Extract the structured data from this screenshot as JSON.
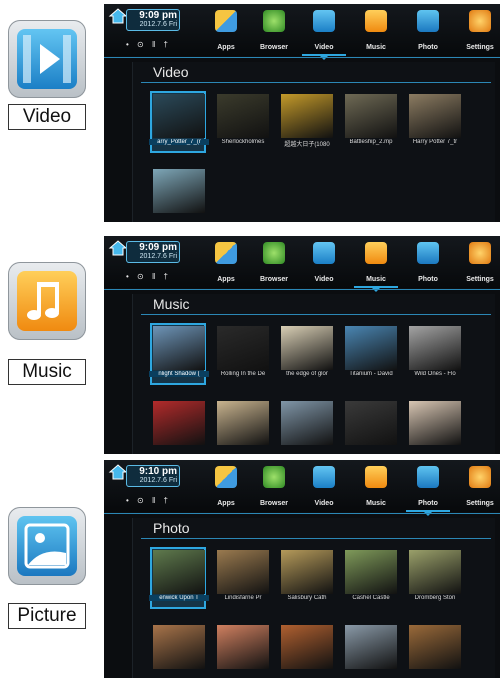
{
  "sidebar": [
    {
      "caption": "Video",
      "icon": "video-app-icon"
    },
    {
      "caption": "Music",
      "icon": "music-app-icon"
    },
    {
      "caption": "Picture",
      "icon": "picture-app-icon"
    }
  ],
  "panels": [
    {
      "time": "9:09 pm",
      "date": "2012.7.6 Fri",
      "status": "• ⊙ ‖ †",
      "tabs": [
        "Apps",
        "Browser",
        "Video",
        "Music",
        "Photo",
        "Settings"
      ],
      "active_tab": "Video",
      "section_title": "Video",
      "items": [
        "arry_Potter_7_(r",
        "Sherlockholmes",
        "超越大日子(1080",
        "Battleship_2.mp",
        "Harry Potter 7_tr",
        ""
      ]
    },
    {
      "time": "9:09 pm",
      "date": "2012.7.6 Fri",
      "status": "• ⊙ ‖ †",
      "tabs": [
        "Apps",
        "Browser",
        "Video",
        "Music",
        "Photo",
        "Settings"
      ],
      "active_tab": "Music",
      "section_title": "Music",
      "items": [
        "nlight Shadow (",
        "Rolling In the De",
        "the edge of glor",
        "Titanium - David",
        "Wild Ones - Flo",
        "",
        "",
        "",
        "",
        ""
      ]
    },
    {
      "time": "9:10 pm",
      "date": "2012.7.6 Fri",
      "status": "• ⊙ ‖ †",
      "tabs": [
        "Apps",
        "Browser",
        "Video",
        "Music",
        "Photo",
        "Settings"
      ],
      "active_tab": "Photo",
      "section_title": "Photo",
      "items": [
        "enwick Upon T",
        "Lindisfarne Pr",
        "Salisbury Cath",
        "Cashel Castle",
        "Dromberg Ston",
        "",
        "",
        "",
        "",
        ""
      ]
    }
  ],
  "colors": {
    "accent": "#2ea7e0",
    "panel_bg": "#0b0d10"
  }
}
